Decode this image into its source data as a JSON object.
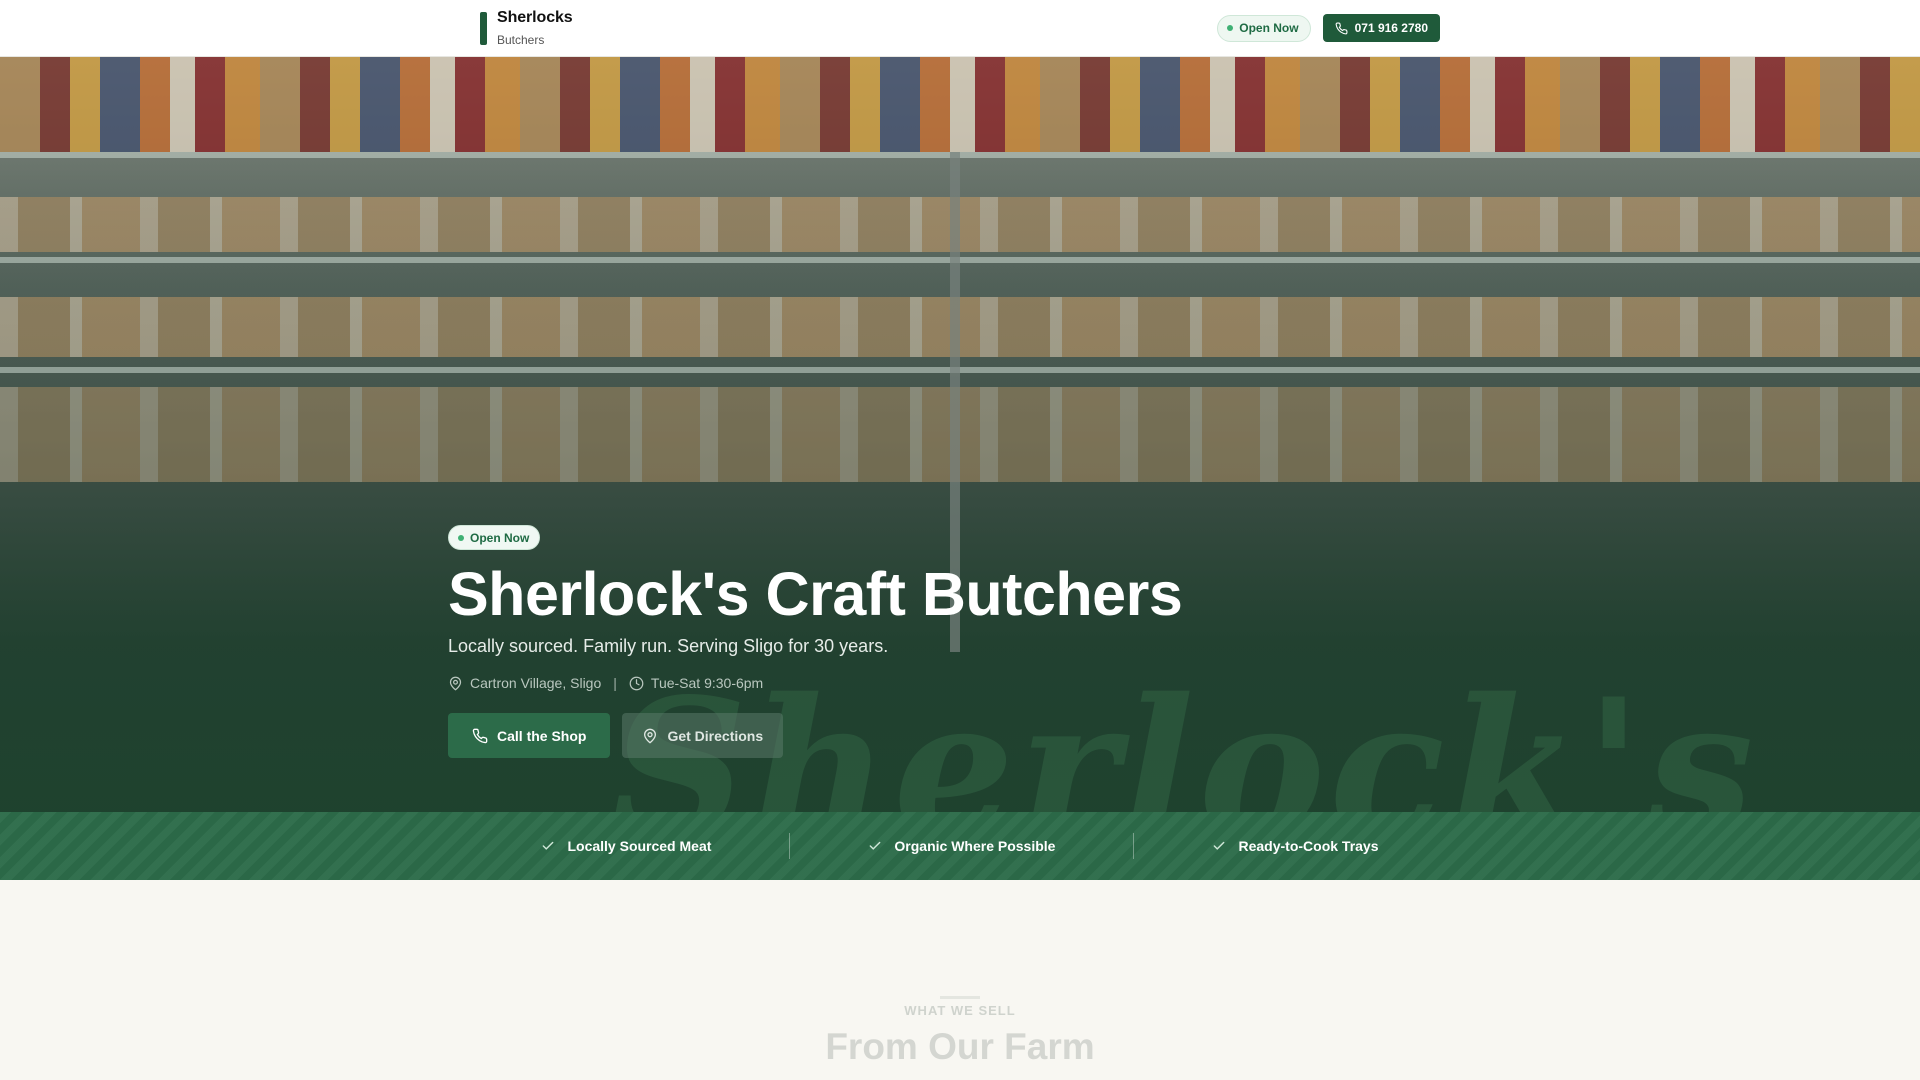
{
  "header": {
    "brand_name": "Sherlocks",
    "brand_sub": "Butchers",
    "status_label": "Open Now",
    "phone_label": "071 916 2780"
  },
  "hero": {
    "badge": "Open Now",
    "title": "Sherlock's Craft Butchers",
    "tagline": "Locally sourced. Family run. Serving Sligo for 30 years.",
    "location": "Cartron Village, Sligo",
    "separator": "|",
    "hours": "Tue-Sat 9:30-6pm",
    "call_button": "Call the Shop",
    "directions_button": "Get Directions",
    "watermark": "Sherlock's"
  },
  "features": [
    {
      "label": "Locally Sourced Meat",
      "icon": "check-icon"
    },
    {
      "label": "Organic Where Possible",
      "icon": "check-icon"
    },
    {
      "label": "Ready-to-Cook Trays",
      "icon": "check-icon"
    }
  ],
  "section": {
    "eyebrow": "WHAT WE SELL",
    "title": "From Our Farm"
  },
  "colors": {
    "brand_green": "#1f5a3a",
    "band_green": "#2c6b49",
    "open_dot": "#3fb074",
    "page_bg": "#f8f7f2"
  },
  "icons": {
    "phone": "phone-icon",
    "location": "map-pin-icon",
    "clock": "clock-icon",
    "check": "check-icon"
  }
}
